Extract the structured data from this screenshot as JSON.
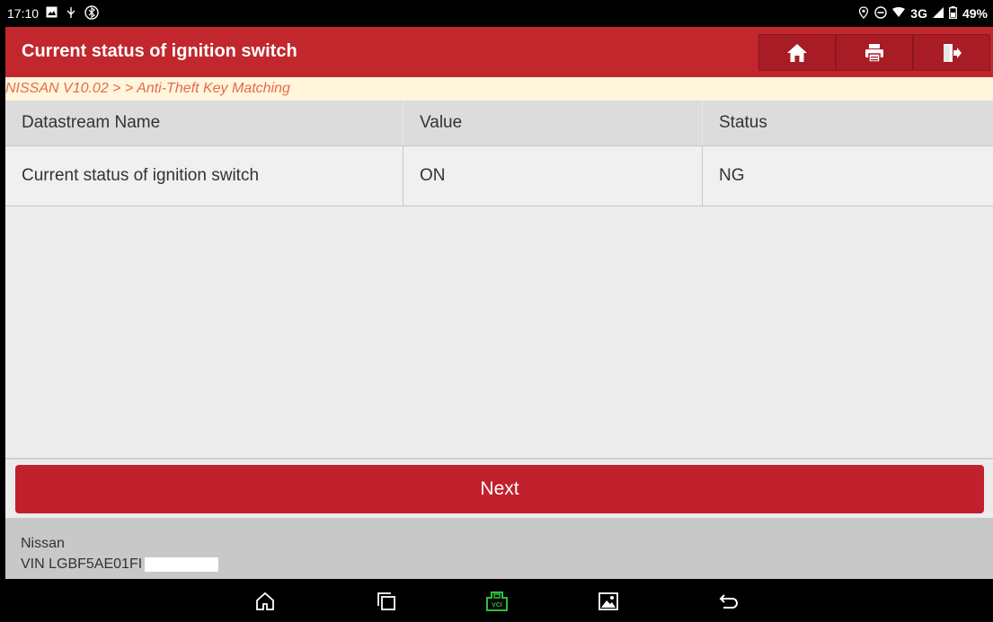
{
  "status_bar": {
    "time": "17:10",
    "network": "3G",
    "battery": "49%"
  },
  "header": {
    "title": "Current status of ignition switch",
    "home_icon": "home-icon",
    "print_icon": "printer-icon",
    "exit_icon": "exit-icon"
  },
  "breadcrumb": "NISSAN V10.02 > > Anti-Theft Key Matching",
  "table": {
    "columns": [
      "Datastream Name",
      "Value",
      "Status"
    ],
    "rows": [
      [
        "Current status of ignition switch",
        "ON",
        "NG"
      ]
    ]
  },
  "next_label": "Next",
  "footer": {
    "make": "Nissan",
    "vin": "VIN LGBF5AE01FI"
  },
  "colors": {
    "accent": "#c1272d",
    "vci_green": "#2fbf3a"
  }
}
